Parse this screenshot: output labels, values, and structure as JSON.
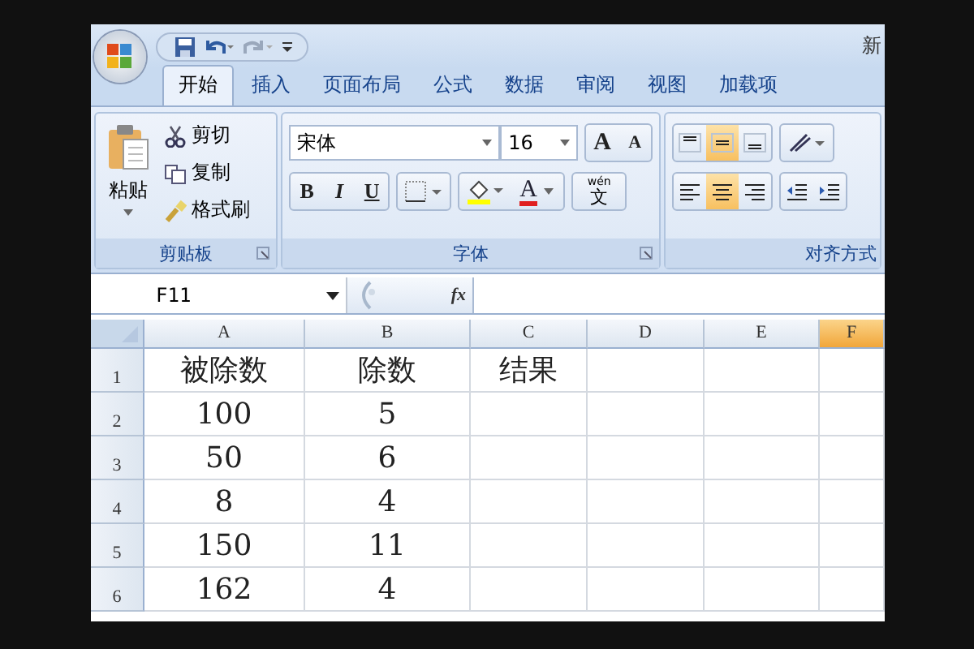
{
  "window": {
    "title": "新"
  },
  "tabs": [
    {
      "label": "开始",
      "selected": true
    },
    {
      "label": "插入",
      "selected": false
    },
    {
      "label": "页面布局",
      "selected": false
    },
    {
      "label": "公式",
      "selected": false
    },
    {
      "label": "数据",
      "selected": false
    },
    {
      "label": "审阅",
      "selected": false
    },
    {
      "label": "视图",
      "selected": false
    },
    {
      "label": "加载项",
      "selected": false
    }
  ],
  "clipboard": {
    "paste": "粘贴",
    "cut": "剪切",
    "copy": "复制",
    "format_painter": "格式刷",
    "label": "剪贴板"
  },
  "font": {
    "name": "宋体",
    "size": "16",
    "grow": "A",
    "shrink": "A",
    "bold": "B",
    "italic": "I",
    "underline": "U",
    "font_color": "A",
    "phonetic": "wén",
    "phonetic_char": "文",
    "label": "字体"
  },
  "alignment": {
    "label": "对齐方式",
    "vertical": [
      {
        "selected": false
      },
      {
        "selected": true
      },
      {
        "selected": false
      }
    ],
    "horizontal": [
      {
        "selected": false
      },
      {
        "selected": true
      },
      {
        "selected": false
      }
    ]
  },
  "formula_bar": {
    "name_box": "F11",
    "function_label": "fx"
  },
  "sheet": {
    "columns": [
      {
        "label": "A",
        "selected": false
      },
      {
        "label": "B",
        "selected": false
      },
      {
        "label": "C",
        "selected": false
      },
      {
        "label": "D",
        "selected": false
      },
      {
        "label": "E",
        "selected": false
      },
      {
        "label": "F",
        "selected": true
      }
    ],
    "rows": [
      {
        "number": "1",
        "cells": [
          "被除数",
          "除数",
          "结果"
        ]
      },
      {
        "number": "2",
        "cells": [
          "100",
          "5"
        ]
      },
      {
        "number": "3",
        "cells": [
          "50",
          "6"
        ]
      },
      {
        "number": "4",
        "cells": [
          "8",
          "4"
        ]
      },
      {
        "number": "5",
        "cells": [
          "150",
          "11"
        ]
      },
      {
        "number": "6",
        "cells": [
          "162",
          "4"
        ]
      }
    ]
  }
}
